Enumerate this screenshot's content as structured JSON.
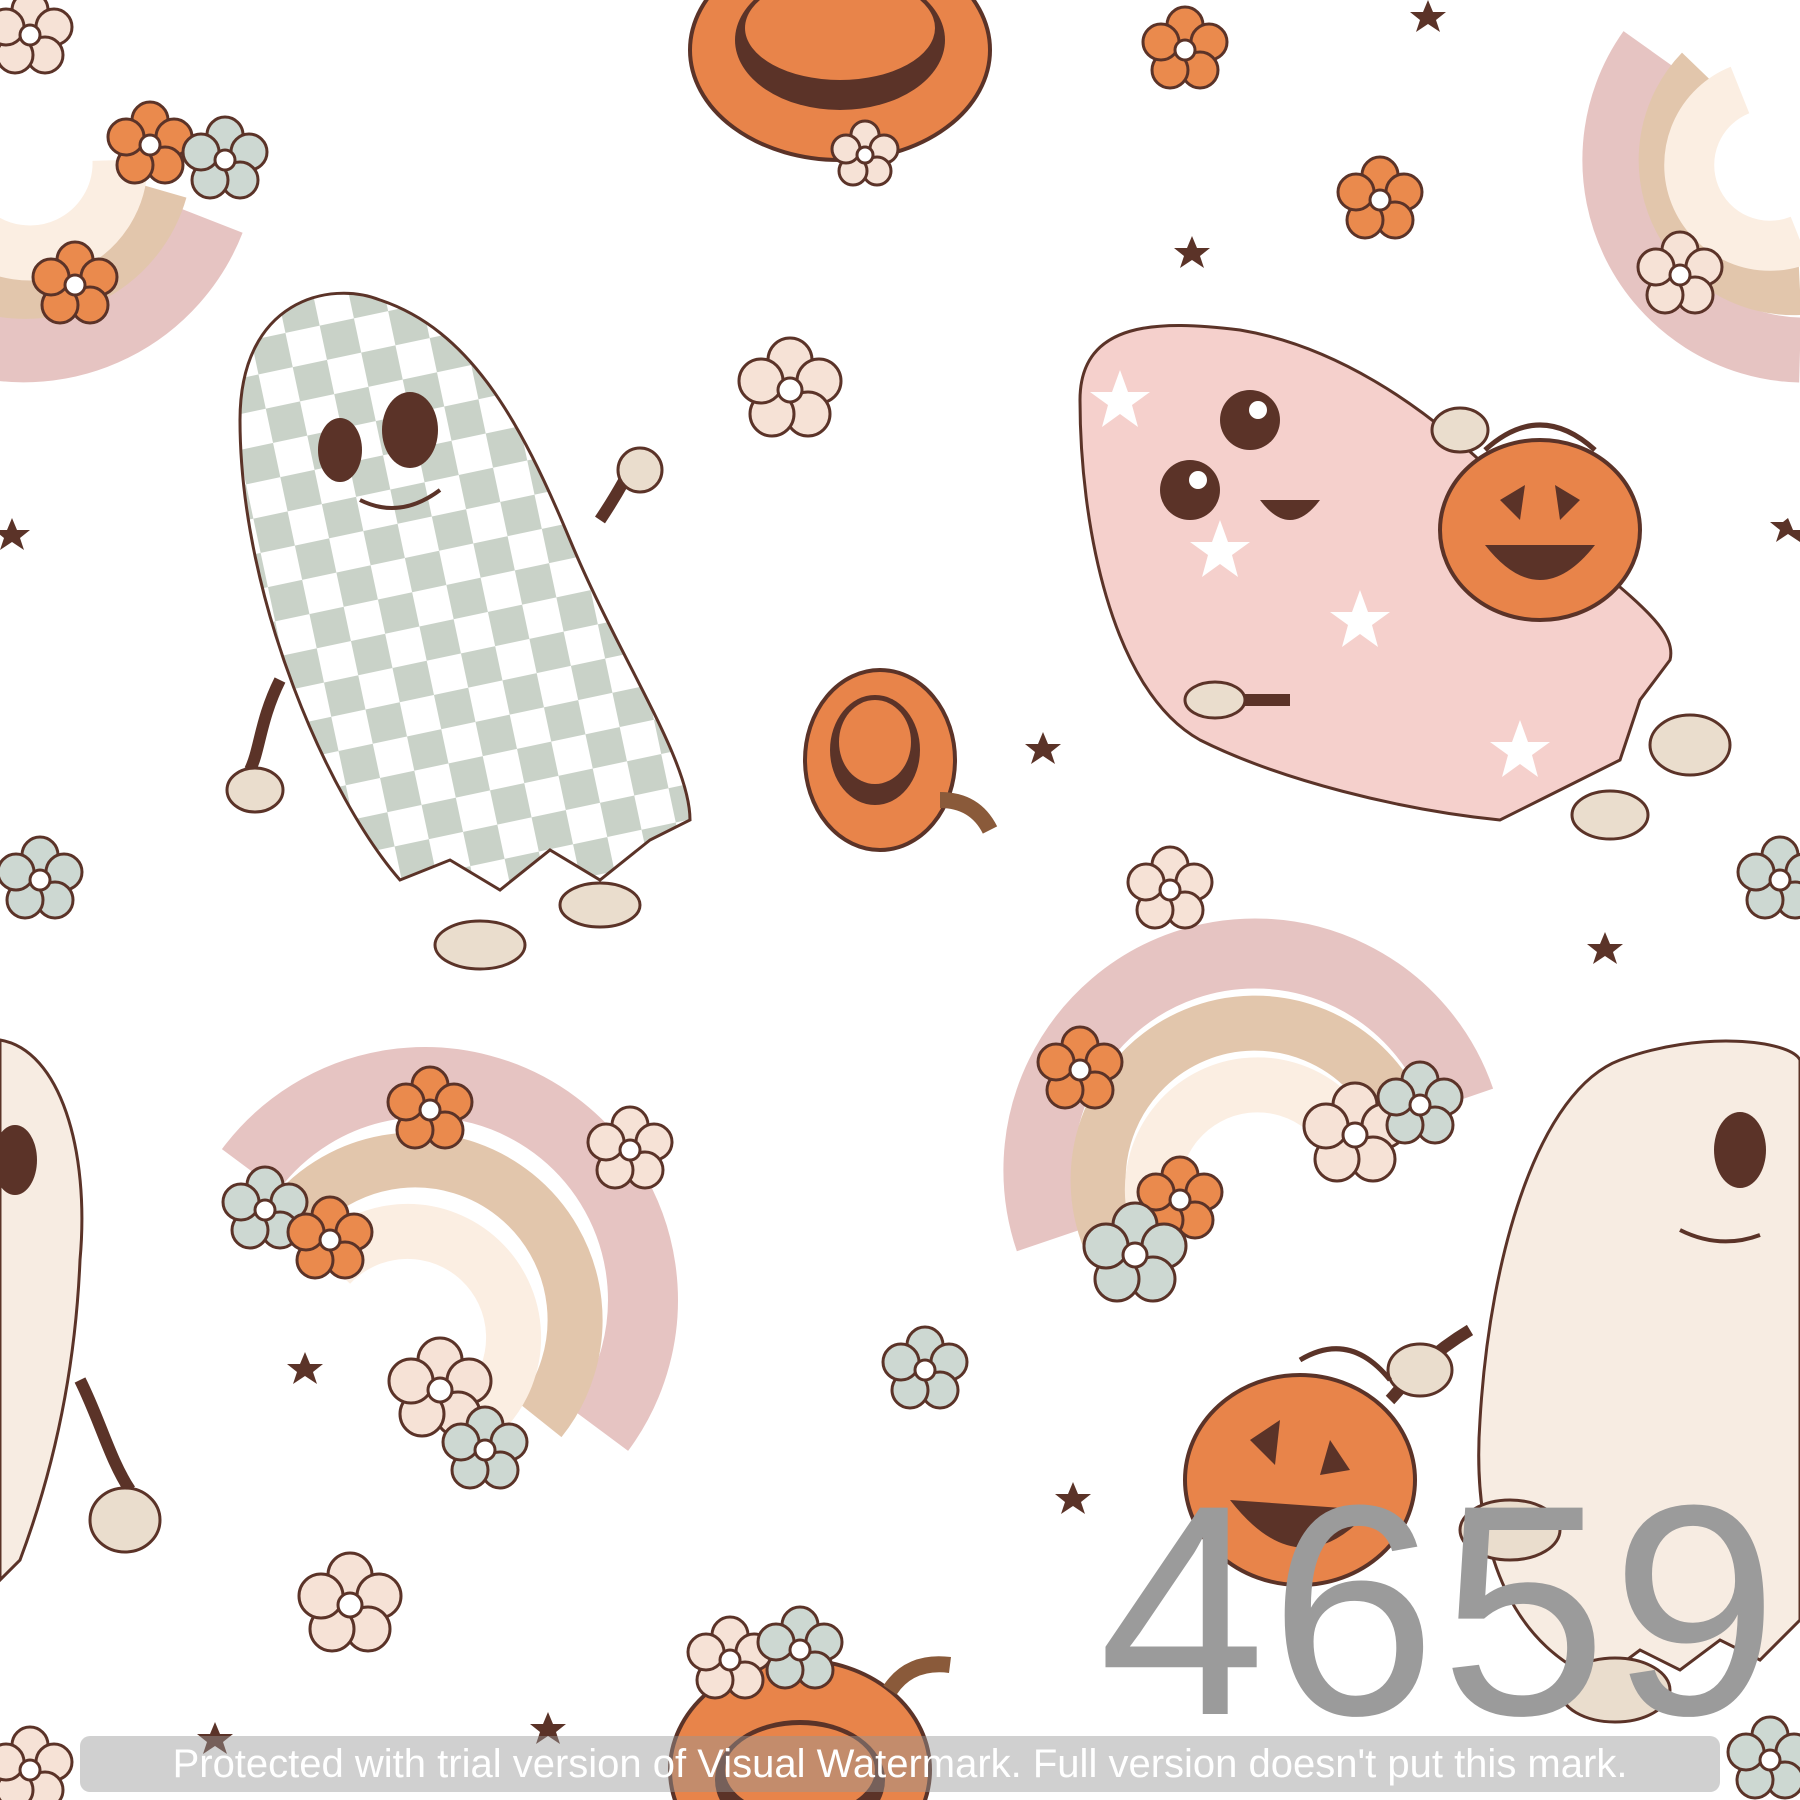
{
  "pattern_code": "4659",
  "watermark_text": "Protected with trial version of Visual Watermark. Full version doesn't put this mark.",
  "colors": {
    "background": "#ffffff",
    "outline": "#5b3328",
    "pumpkin": "#e8844a",
    "pumpkin_dark": "#b95a2e",
    "sage": "#c9d2c8",
    "ghost_pink": "#f5d0cc",
    "ghost_cream": "#f7ece2",
    "rainbow_pink": "#e6c4c2",
    "rainbow_tan": "#e2c6ac",
    "rainbow_cream": "#fbeee2",
    "flower_orange": "#ea8a4d",
    "flower_blush": "#f6e2d6",
    "flower_sage": "#cdd8d2",
    "code_gray": "#9b9b9b"
  },
  "icons": [
    "ghost-checkered-icon",
    "ghost-pink-stars-icon",
    "ghost-cream-cobweb-icon",
    "pumpkin-icon",
    "rainbow-icon",
    "flower-icon",
    "star-icon"
  ]
}
